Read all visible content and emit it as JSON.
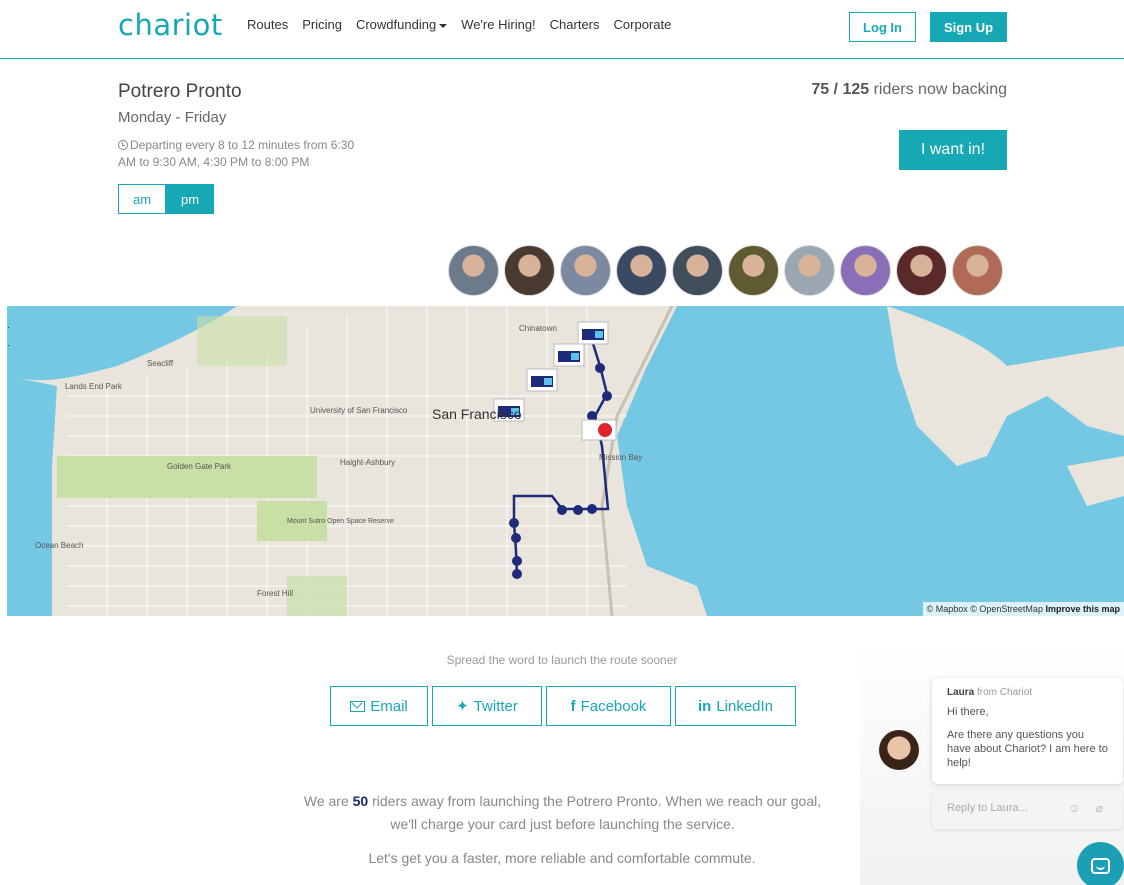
{
  "nav": {
    "logo": "chariot",
    "links": [
      "Routes",
      "Pricing",
      "Crowdfunding",
      "We're Hiring!",
      "Charters",
      "Corporate"
    ],
    "login": "Log In",
    "signup": "Sign Up"
  },
  "route": {
    "name": "Potrero Pronto",
    "days": "Monday - Friday",
    "departing": "Departing every 8 to 12 minutes from 6:30 AM to 9:30 AM, 4:30 PM to 8:00 PM",
    "toggle_am": "am",
    "toggle_pm": "pm",
    "backing_count": "75 / 125",
    "backing_text": "riders now backing",
    "cta": "I want in!"
  },
  "avatars": [
    {
      "bg": "#6b7b8c"
    },
    {
      "bg": "#4a3a30"
    },
    {
      "bg": "#7b8aa0"
    },
    {
      "bg": "#3b4a63"
    },
    {
      "bg": "#3f4e5a"
    },
    {
      "bg": "#5f5a30"
    },
    {
      "bg": "#9aa7b3"
    },
    {
      "bg": "#8a6fb8"
    },
    {
      "bg": "#5a2a2a"
    },
    {
      "bg": "#b06a55"
    }
  ],
  "map": {
    "labels": {
      "seacliff": "Seacliff",
      "lands_end": "Lands End Park",
      "univ": "University of San Francisco",
      "sf": "San Francisco",
      "golden_gate": "Golden Gate Park",
      "haight": "Haight-Ashbury",
      "mission_bay": "Mission Bay",
      "chinatown": "Chinatown",
      "ocean_beach": "Ocean Beach",
      "mount_sutro": "Mount Sutro Open Space Reserve",
      "forest_hill": "Forest Hill"
    },
    "credit": "© Mapbox © OpenStreetMap",
    "credit_link": "Improve this map",
    "route_color": "#1e2a7a",
    "ctrl": "· ·"
  },
  "share": {
    "spread": "Spread the word to launch the route sooner",
    "email": "Email",
    "twitter": "Twitter",
    "facebook": "Facebook",
    "linkedin": "LinkedIn"
  },
  "goal": {
    "pre": "We are",
    "count": "50",
    "post": "riders away from launching the Potrero Pronto. When we reach our goal, we'll charge your card just before launching the service.",
    "commute": "Let's get you a faster, more reliable and comfortable commute."
  },
  "chat": {
    "sender": "Laura",
    "from": "from Chariot",
    "greeting": "Hi there,",
    "message": "Are there any questions you have about Chariot? I am here to help!",
    "reply_placeholder": "Reply to Laura...",
    "reply_icons": "☺ ⌀"
  }
}
